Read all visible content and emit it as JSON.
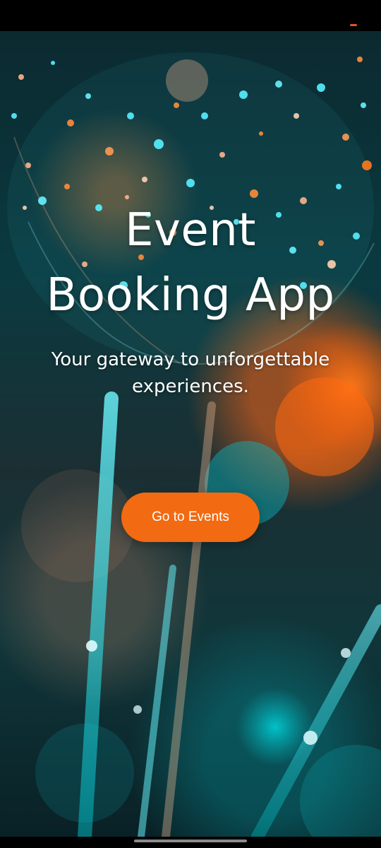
{
  "hero": {
    "title_line1": "Event",
    "title_line2": "Booking App",
    "subtitle_line1": "Your gateway to unforgettable",
    "subtitle_line2": "experiences."
  },
  "cta": {
    "label": "Go to Events"
  },
  "colors": {
    "accent": "#f26a12",
    "status_indicator": "#e2532b",
    "text": "#ffffff"
  },
  "background": {
    "icon": "bokeh-lights-photo"
  }
}
